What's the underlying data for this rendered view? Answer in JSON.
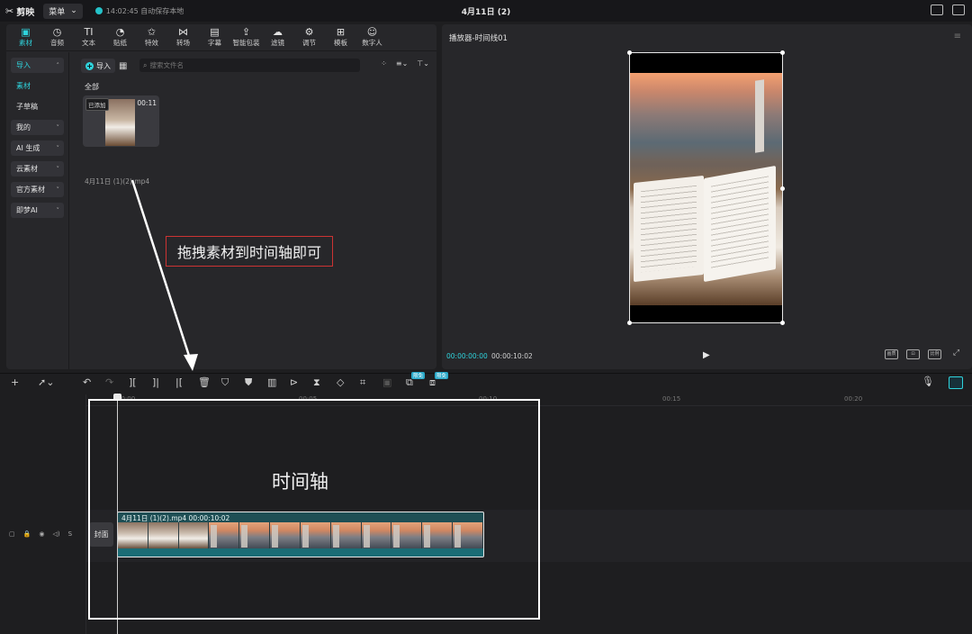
{
  "app": {
    "name": "剪映",
    "menu_label": "菜单",
    "save_status": "14:02:45 自动保存本地",
    "project_title": "4月11日 (2)"
  },
  "tool_tabs": [
    {
      "label": "素材",
      "icon": "media-icon",
      "glyph": "▣"
    },
    {
      "label": "音频",
      "icon": "audio-icon",
      "glyph": "◷"
    },
    {
      "label": "文本",
      "icon": "text-icon",
      "glyph": "TI"
    },
    {
      "label": "贴纸",
      "icon": "sticker-icon",
      "glyph": "◔"
    },
    {
      "label": "特效",
      "icon": "effects-icon",
      "glyph": "✩"
    },
    {
      "label": "转场",
      "icon": "transition-icon",
      "glyph": "⋈"
    },
    {
      "label": "字幕",
      "icon": "subtitle-icon",
      "glyph": "▤"
    },
    {
      "label": "智能包装",
      "icon": "smart-pack-icon",
      "glyph": "⇪"
    },
    {
      "label": "滤镜",
      "icon": "filter-icon",
      "glyph": "☁"
    },
    {
      "label": "调节",
      "icon": "adjust-icon",
      "glyph": "⚙"
    },
    {
      "label": "模板",
      "icon": "template-icon",
      "glyph": "⊞"
    },
    {
      "label": "数字人",
      "icon": "digital-human-icon",
      "glyph": "☺"
    }
  ],
  "sidebar": {
    "items": [
      {
        "label": "导入",
        "style": "box cyan",
        "chevron": "˄"
      },
      {
        "label": "素材",
        "style": "plain cyan",
        "chevron": ""
      },
      {
        "label": "子草稿",
        "style": "plain",
        "chevron": ""
      },
      {
        "label": "我的",
        "style": "box",
        "chevron": "˅"
      },
      {
        "label": "AI 生成",
        "style": "box",
        "chevron": "˅"
      },
      {
        "label": "云素材",
        "style": "box",
        "chevron": "˅"
      },
      {
        "label": "官方素材",
        "style": "box",
        "chevron": "˅"
      },
      {
        "label": "即梦AI",
        "style": "box",
        "chevron": "˅"
      }
    ]
  },
  "media": {
    "import_label": "导入",
    "search_placeholder": "搜索文件名",
    "section_label": "全部",
    "clip": {
      "badge": "已添加",
      "duration": "00:11",
      "name": "4月11日 (1)(2).mp4"
    }
  },
  "annotation": {
    "text": "拖拽素材到时间轴即可",
    "timeline_text": "时间轴"
  },
  "player": {
    "title": "播放器-时间线01",
    "current_time": "00:00:00:00",
    "total_time": "00:00:10:02",
    "buttons": [
      "画质",
      "",
      "比例",
      ""
    ]
  },
  "timeline": {
    "ruler_labels": [
      "00:00",
      "00:05",
      "00:10",
      "00:15",
      "00:20"
    ],
    "free_badge": "限免",
    "cover_label": "封面",
    "clip_label": "4月11日 (1)(2).mp4  00:00:10:02",
    "track_ctrls": [
      "▢",
      "🔒",
      "◉",
      "◁)",
      "S"
    ]
  }
}
